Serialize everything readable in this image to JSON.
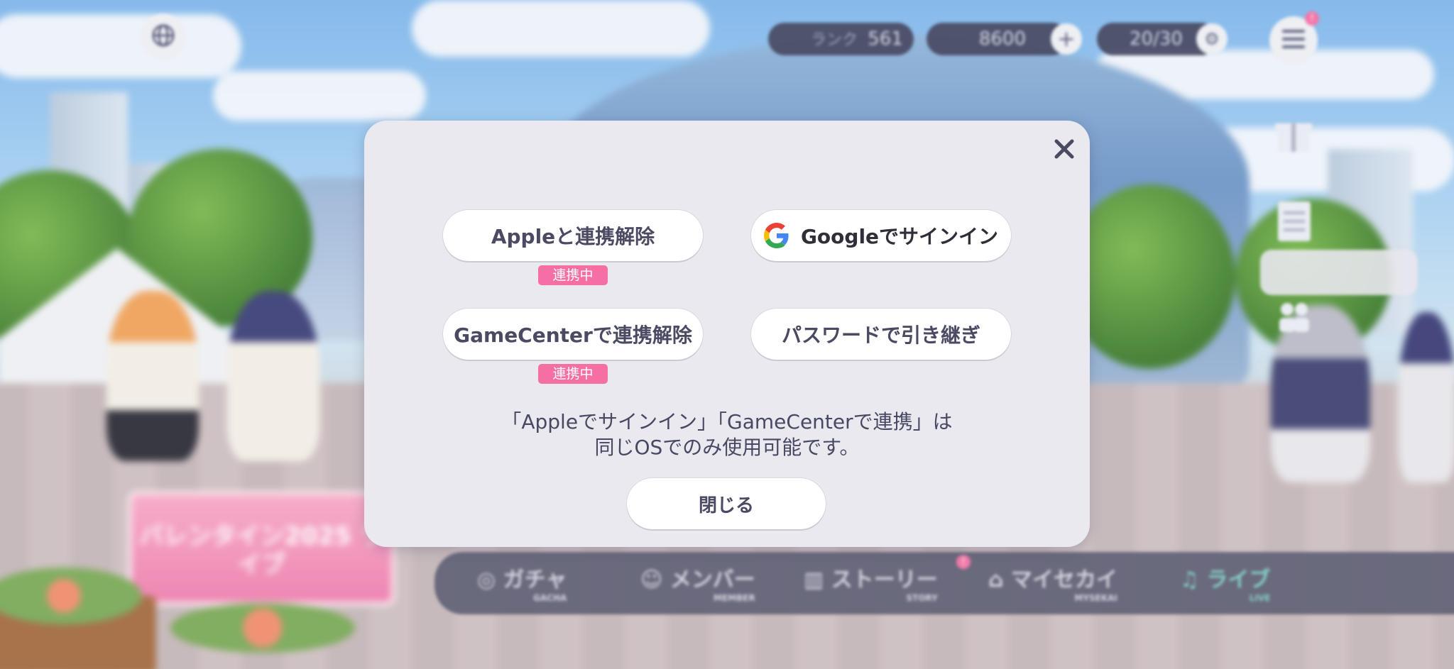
{
  "hud": {
    "rank_label": "ランク",
    "rank_value": "561",
    "currency_value": "8600",
    "stamina_value": "20/30",
    "stamina_tag": "",
    "menu_badge": "!"
  },
  "nav": {
    "items": [
      {
        "label": "ガチャ",
        "sub": "GACHA"
      },
      {
        "label": "メンバー",
        "sub": "MEMBER"
      },
      {
        "label": "ストーリー",
        "sub": "STORY"
      },
      {
        "label": "マイセカイ",
        "sub": "MYSEKAI"
      },
      {
        "label": "ライブ",
        "sub": "LIVE"
      }
    ],
    "story_badge": "!"
  },
  "event_banner": {
    "text": "バレンタイン2025 ライブ"
  },
  "dialog": {
    "apple_button": "Appleと連携解除",
    "apple_status": "連携中",
    "google_button": "Googleでサインイン",
    "gamecenter_button": "GameCenterで連携解除",
    "gamecenter_status": "連携中",
    "password_button": "パスワードで引き継ぎ",
    "note_line1": "「Appleでサインイン」「GameCenterで連携」は",
    "note_line2": "同じOSでのみ使用可能です。",
    "close_button": "閉じる"
  },
  "icons": {
    "close": "close-icon",
    "google": "google-g-icon",
    "globe": "globe-icon",
    "menu": "hamburger-menu-icon",
    "gift": "gift-icon",
    "notice": "notice-board-icon"
  },
  "colors": {
    "dialog_bg": "#e9e9ef",
    "button_bg": "#ffffff",
    "button_text": "#4a4a63",
    "status_badge": "#f56ea4",
    "nav_active": "#79d3c5"
  }
}
